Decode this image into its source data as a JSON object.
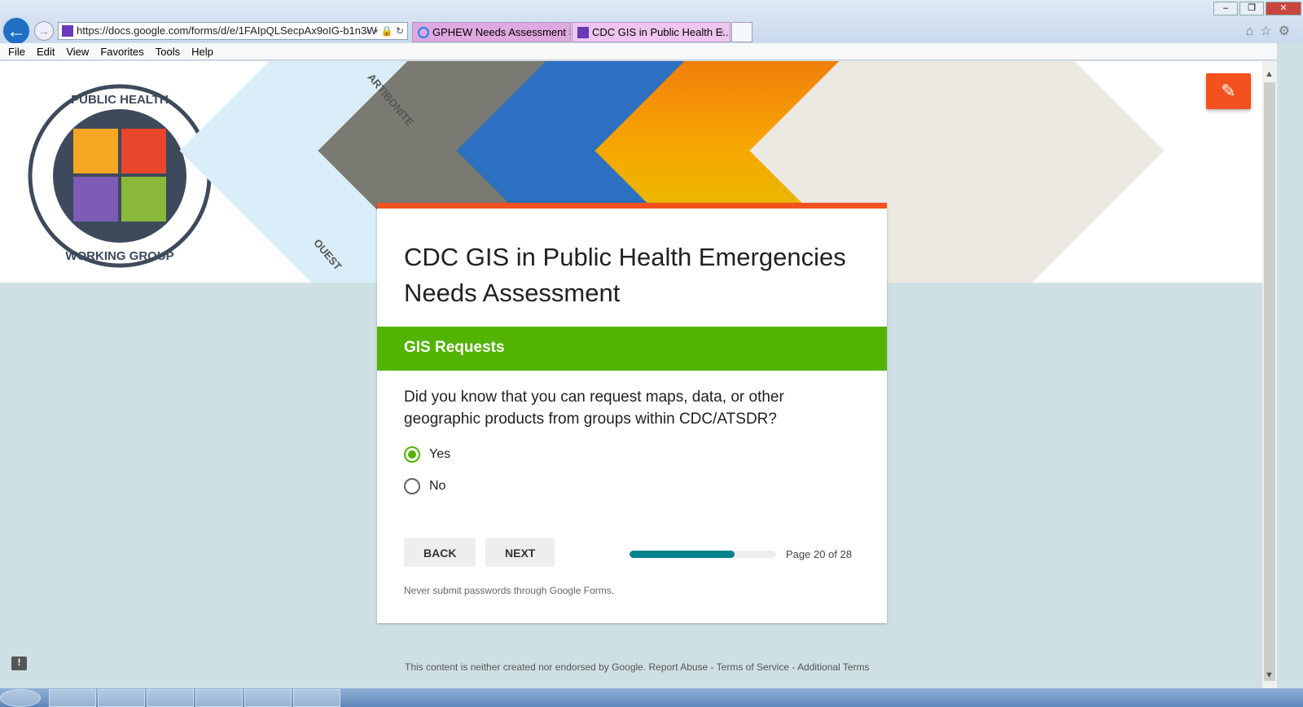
{
  "browser": {
    "url": "https://docs.google.com/forms/d/e/1FAIpQLSecpAx9oIG-b1n3W",
    "tabs": [
      {
        "label": "GPHEW Needs Assessment Su..."
      },
      {
        "label": "CDC GIS in Public Health E...",
        "close": "×"
      }
    ],
    "menu": [
      "File",
      "Edit",
      "View",
      "Favorites",
      "Tools",
      "Help"
    ]
  },
  "banner": {
    "logo_text": "GIS IN PUBLIC HEALTH EMERGENCIES WORKING GROUP",
    "map_labels": [
      "ARTIBONITE",
      "OUEST"
    ]
  },
  "form": {
    "title": "CDC GIS in Public Health Emergencies Needs Assessment",
    "section": "GIS Requests",
    "question": "Did you know that you can request maps, data, or other geographic products from groups within CDC/ATSDR?",
    "options": [
      {
        "label": "Yes",
        "selected": true
      },
      {
        "label": "No",
        "selected": false
      }
    ],
    "back": "BACK",
    "next": "NEXT",
    "progress_fraction": 0.714,
    "page_text": "Page 20 of 28",
    "warning": "Never submit passwords through Google Forms."
  },
  "footer": "This content is neither created nor endorsed by Google. Report Abuse - Terms of Service - Additional Terms",
  "colors": {
    "accent": "#f4511e",
    "section": "#52b300",
    "progress": "#00838f",
    "background": "#cfe0e4"
  }
}
